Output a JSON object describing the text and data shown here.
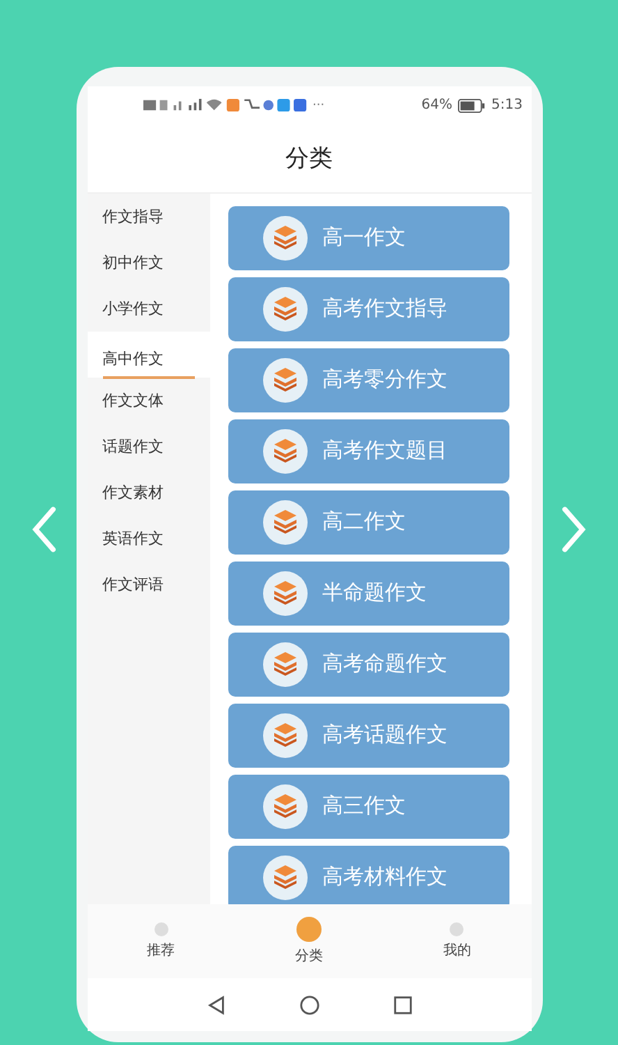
{
  "status_bar": {
    "battery_text": "64%",
    "time": "5:13",
    "more": "···"
  },
  "header": {
    "title": "分类"
  },
  "sidebar": {
    "items": [
      {
        "label": "作文指导",
        "selected": false
      },
      {
        "label": "初中作文",
        "selected": false
      },
      {
        "label": "小学作文",
        "selected": false
      },
      {
        "label": "高中作文",
        "selected": true
      },
      {
        "label": "作文文体",
        "selected": false
      },
      {
        "label": "话题作文",
        "selected": false
      },
      {
        "label": "作文素材",
        "selected": false
      },
      {
        "label": "英语作文",
        "selected": false
      },
      {
        "label": "作文评语",
        "selected": false
      }
    ]
  },
  "categories": [
    "高一作文",
    "高考作文指导",
    "高考零分作文",
    "高考作文题目",
    "高二作文",
    "半命题作文",
    "高考命题作文",
    "高考话题作文",
    "高三作文",
    "高考材料作文"
  ],
  "tab_bar": [
    {
      "label": "推荐",
      "selected": false
    },
    {
      "label": "分类",
      "selected": true
    },
    {
      "label": "我的",
      "selected": false
    }
  ]
}
